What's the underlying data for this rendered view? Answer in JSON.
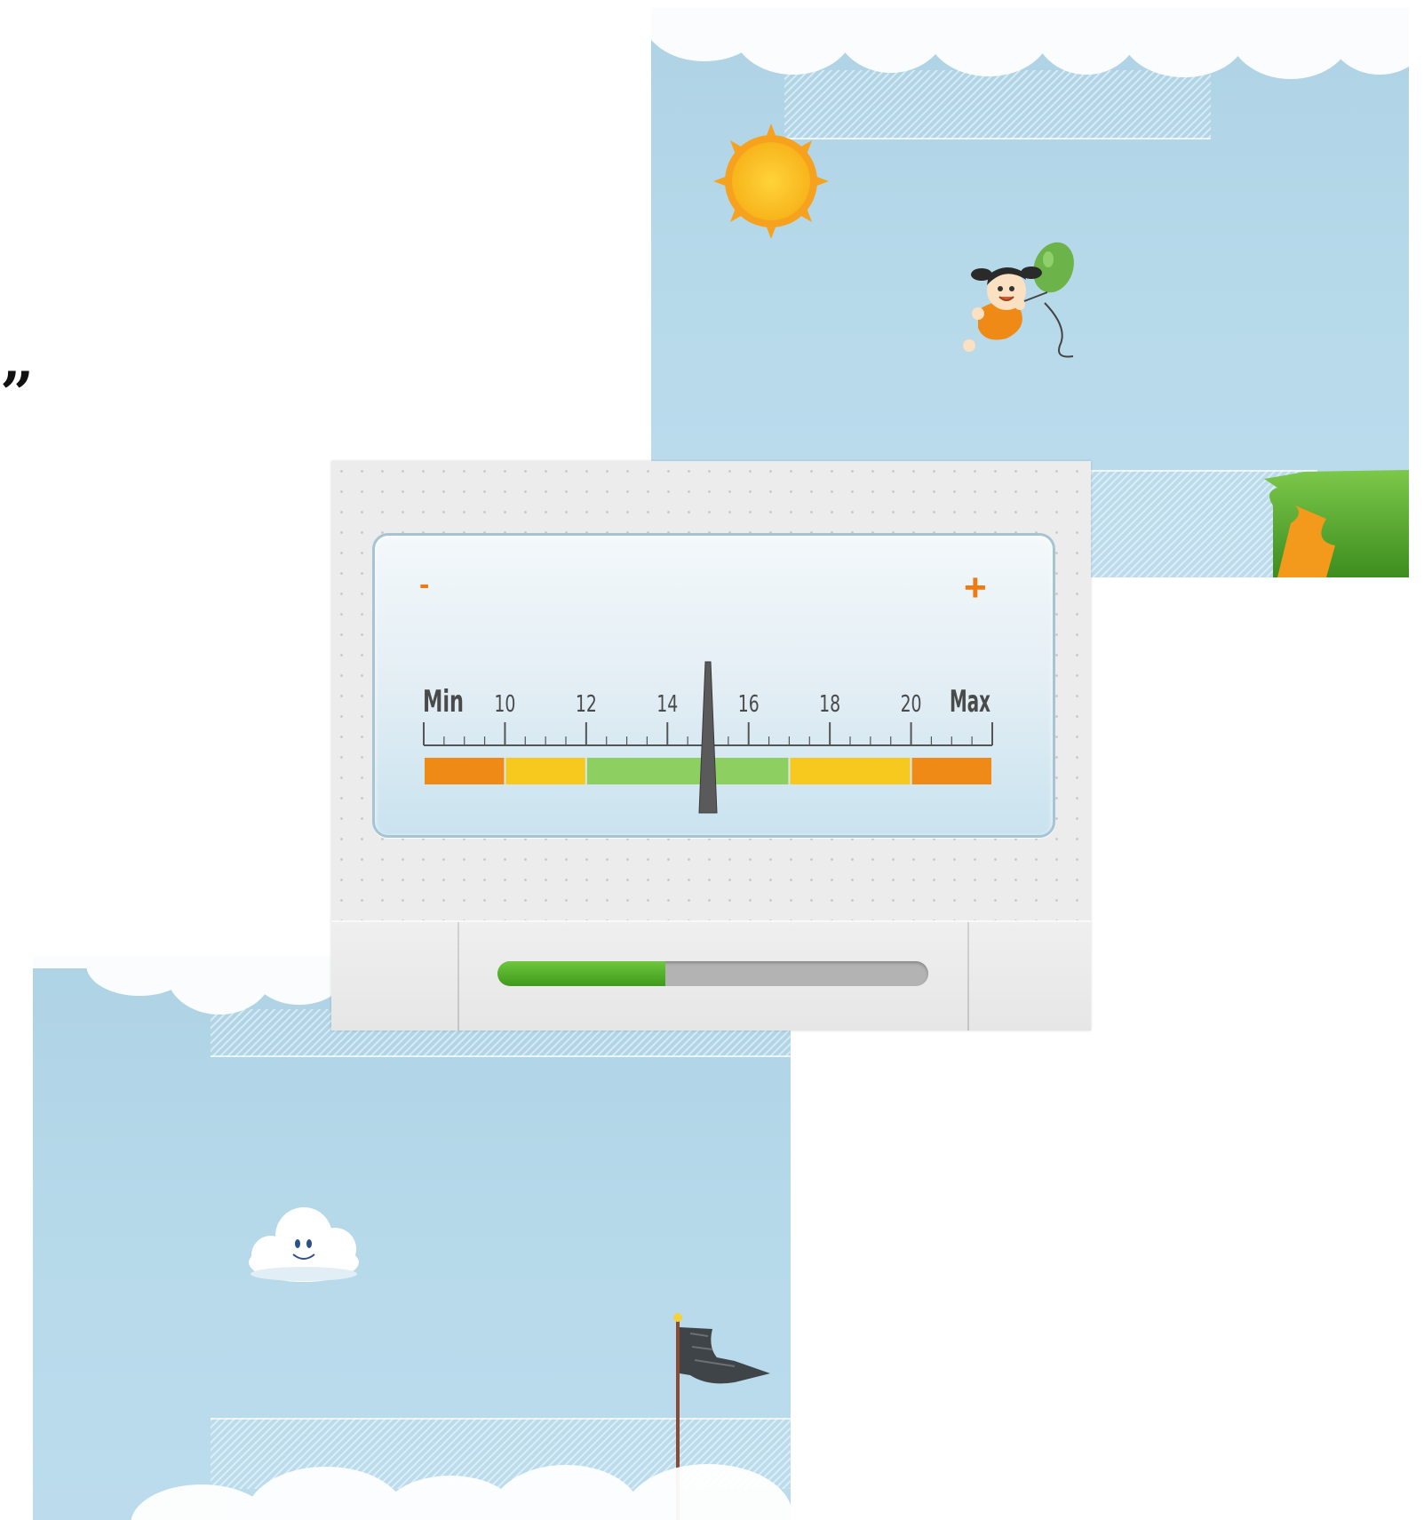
{
  "quote_mark": "”",
  "sky_panel_top": {
    "sun_icon": "sun-icon",
    "girl_icon": "girl-with-balloon-icon",
    "balloon_color": "#6cb449",
    "grass_icon": "grass-hill-icon"
  },
  "gauge": {
    "minus_label": "-",
    "plus_label": "+",
    "scale_labels": [
      "Min",
      "10",
      "12",
      "14",
      "16",
      "18",
      "20",
      "Max"
    ],
    "needle_value": 15,
    "zones": [
      {
        "color": "#f08a17"
      },
      {
        "color": "#f7c91e"
      },
      {
        "color": "#8ecf62"
      },
      {
        "color": "#8ecf62"
      },
      {
        "color": "#f7c91e"
      },
      {
        "color": "#f08a17"
      }
    ],
    "progress_percent": 39
  },
  "sky_panel_bottom": {
    "cloud_icon": "smiling-cloud-icon",
    "flag_icon": "checkered-flag-icon"
  },
  "colors": {
    "sky": "#b6d9ea",
    "accent_orange": "#ee7a12",
    "progress_green": "#4fae27"
  }
}
